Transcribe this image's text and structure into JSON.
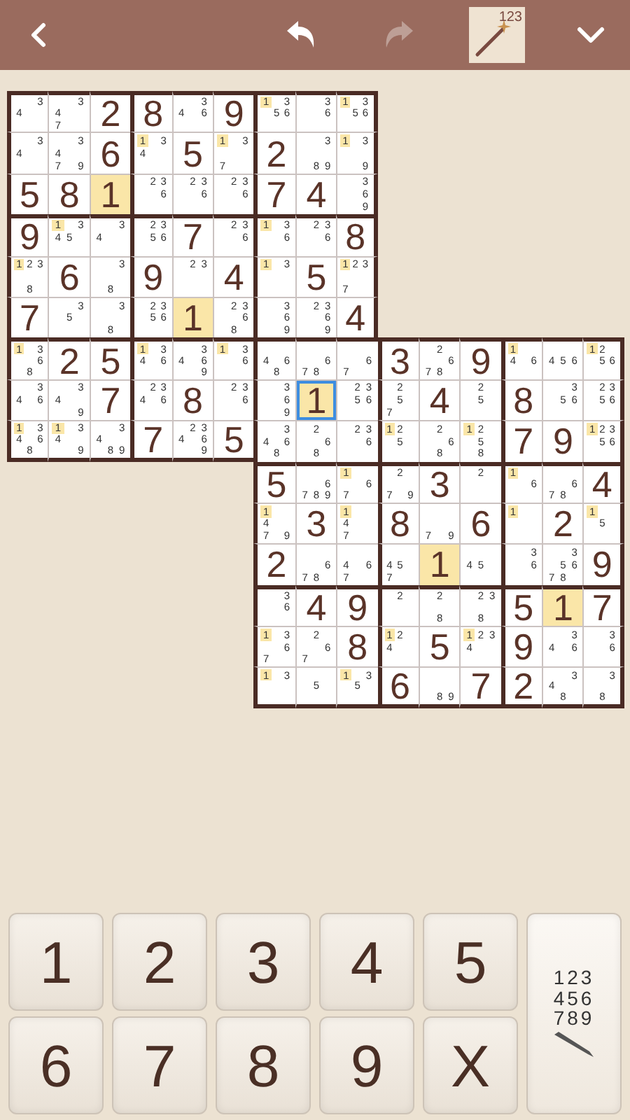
{
  "toolbar": {
    "undo": {
      "disabled": false
    },
    "redo": {
      "disabled": true
    },
    "hint": {
      "label": "123",
      "selected": true
    }
  },
  "board": {
    "rows": [
      {
        "cells": [
          {
            "kind": "notes",
            "notes": [
              "3",
              "4"
            ],
            "highlighted": false,
            "selected": false
          },
          {
            "kind": "notes",
            "notes": [
              "3",
              "4",
              "7"
            ],
            "highlighted": false,
            "selected": false
          },
          {
            "kind": "value",
            "text": "2",
            "highlighted": false,
            "selected": false
          },
          {
            "kind": "value",
            "text": "8",
            "highlighted": false,
            "selected": false
          },
          {
            "kind": "notes",
            "notes": [
              "3",
              "4",
              "6"
            ],
            "highlighted": false,
            "selected": false
          },
          {
            "kind": "value",
            "text": "9",
            "highlighted": false,
            "selected": false
          },
          {
            "kind": "notes",
            "notes": [
              "1",
              "3",
              "5",
              "6"
            ],
            "highlighted": true,
            "selected": false
          },
          {
            "kind": "notes",
            "notes": [
              "3",
              "6"
            ],
            "highlighted": false,
            "selected": false
          },
          {
            "kind": "notes",
            "notes": [
              "1",
              "3",
              "5",
              "6"
            ],
            "highlighted": true,
            "selected": false
          }
        ]
      },
      {
        "cells": [
          {
            "kind": "notes",
            "notes": [
              "3",
              "4"
            ],
            "highlighted": false,
            "selected": false
          },
          {
            "kind": "notes",
            "notes": [
              "3",
              "4",
              "7",
              "9"
            ],
            "highlighted": false,
            "selected": false
          },
          {
            "kind": "value",
            "text": "6",
            "highlighted": false,
            "selected": false
          },
          {
            "kind": "notes",
            "notes": [
              "1",
              "3",
              "4"
            ],
            "highlighted": true,
            "selected": false
          },
          {
            "kind": "value",
            "text": "5",
            "highlighted": false,
            "selected": false
          },
          {
            "kind": "notes",
            "notes": [
              "1",
              "3",
              "7"
            ],
            "highlighted": true,
            "selected": false
          },
          {
            "kind": "value",
            "text": "2",
            "highlighted": false,
            "selected": false
          },
          {
            "kind": "notes",
            "notes": [
              "3",
              "8",
              "9"
            ],
            "highlighted": false,
            "selected": false
          },
          {
            "kind": "notes",
            "notes": [
              "1",
              "3",
              "9"
            ],
            "highlighted": true,
            "selected": false
          }
        ]
      },
      {
        "cells": [
          {
            "kind": "value",
            "text": "5",
            "highlighted": false,
            "selected": false
          },
          {
            "kind": "value",
            "text": "8",
            "highlighted": false,
            "selected": false
          },
          {
            "kind": "value",
            "text": "1",
            "highlighted": true,
            "selected": false
          },
          {
            "kind": "notes",
            "notes": [
              "2",
              "3",
              "6"
            ],
            "highlighted": false,
            "selected": false
          },
          {
            "kind": "notes",
            "notes": [
              "2",
              "3",
              "6"
            ],
            "highlighted": false,
            "selected": false
          },
          {
            "kind": "notes",
            "notes": [
              "2",
              "3",
              "6"
            ],
            "highlighted": false,
            "selected": false
          },
          {
            "kind": "value",
            "text": "7",
            "highlighted": false,
            "selected": false
          },
          {
            "kind": "value",
            "text": "4",
            "highlighted": false,
            "selected": false
          },
          {
            "kind": "notes",
            "notes": [
              "3",
              "6",
              "9"
            ],
            "highlighted": false,
            "selected": false
          }
        ]
      },
      {
        "cells": [
          {
            "kind": "value",
            "text": "9",
            "highlighted": false,
            "selected": false
          },
          {
            "kind": "notes",
            "notes": [
              "1",
              "3",
              "4",
              "5"
            ],
            "highlighted": true,
            "selected": false
          },
          {
            "kind": "notes",
            "notes": [
              "3",
              "4"
            ],
            "highlighted": false,
            "selected": false
          },
          {
            "kind": "notes",
            "notes": [
              "2",
              "3",
              "5",
              "6"
            ],
            "highlighted": false,
            "selected": false
          },
          {
            "kind": "value",
            "text": "7",
            "highlighted": false,
            "selected": false
          },
          {
            "kind": "notes",
            "notes": [
              "2",
              "3",
              "6"
            ],
            "highlighted": false,
            "selected": false
          },
          {
            "kind": "notes",
            "notes": [
              "1",
              "3",
              "6"
            ],
            "highlighted": true,
            "selected": false
          },
          {
            "kind": "notes",
            "notes": [
              "2",
              "3",
              "6"
            ],
            "highlighted": false,
            "selected": false
          },
          {
            "kind": "value",
            "text": "8",
            "highlighted": false,
            "selected": false
          }
        ]
      },
      {
        "cells": [
          {
            "kind": "notes",
            "notes": [
              "1",
              "2",
              "3",
              "8"
            ],
            "highlighted": true,
            "selected": false
          },
          {
            "kind": "value",
            "text": "6",
            "highlighted": false,
            "selected": false
          },
          {
            "kind": "notes",
            "notes": [
              "3",
              "8"
            ],
            "highlighted": false,
            "selected": false
          },
          {
            "kind": "value",
            "text": "9",
            "highlighted": false,
            "selected": false
          },
          {
            "kind": "notes",
            "notes": [
              "2",
              "3"
            ],
            "highlighted": false,
            "selected": false
          },
          {
            "kind": "value",
            "text": "4",
            "highlighted": false,
            "selected": false
          },
          {
            "kind": "notes",
            "notes": [
              "1",
              "3"
            ],
            "highlighted": true,
            "selected": false
          },
          {
            "kind": "value",
            "text": "5",
            "highlighted": false,
            "selected": false
          },
          {
            "kind": "notes",
            "notes": [
              "1",
              "2",
              "3",
              "7"
            ],
            "highlighted": true,
            "selected": false
          }
        ]
      },
      {
        "cells": [
          {
            "kind": "value",
            "text": "7",
            "highlighted": false,
            "selected": false
          },
          {
            "kind": "notes",
            "notes": [
              "3",
              "5"
            ],
            "highlighted": false,
            "selected": false
          },
          {
            "kind": "notes",
            "notes": [
              "3",
              "8"
            ],
            "highlighted": false,
            "selected": false
          },
          {
            "kind": "notes",
            "notes": [
              "2",
              "3",
              "5",
              "6"
            ],
            "highlighted": false,
            "selected": false
          },
          {
            "kind": "value",
            "text": "1",
            "highlighted": true,
            "selected": false
          },
          {
            "kind": "notes",
            "notes": [
              "2",
              "3",
              "6",
              "8"
            ],
            "highlighted": false,
            "selected": false
          },
          {
            "kind": "notes",
            "notes": [
              "3",
              "6",
              "9"
            ],
            "highlighted": false,
            "selected": false
          },
          {
            "kind": "notes",
            "notes": [
              "2",
              "3",
              "6",
              "9"
            ],
            "highlighted": false,
            "selected": false
          },
          {
            "kind": "value",
            "text": "4",
            "highlighted": false,
            "selected": false
          }
        ]
      },
      {
        "cells": [
          {
            "kind": "notes",
            "notes": [
              "1",
              "3",
              "6",
              "8"
            ],
            "highlighted": true,
            "selected": false
          },
          {
            "kind": "value",
            "text": "2",
            "highlighted": false,
            "selected": false
          },
          {
            "kind": "value",
            "text": "5",
            "highlighted": false,
            "selected": false
          },
          {
            "kind": "notes",
            "notes": [
              "1",
              "3",
              "4",
              "6"
            ],
            "highlighted": true,
            "selected": false
          },
          {
            "kind": "notes",
            "notes": [
              "3",
              "4",
              "6",
              "9"
            ],
            "highlighted": false,
            "selected": false
          },
          {
            "kind": "notes",
            "notes": [
              "1",
              "3",
              "6"
            ],
            "highlighted": true,
            "selected": false
          },
          {
            "kind": "notes",
            "notes": [
              "4",
              "6",
              "8"
            ],
            "highlighted": false,
            "selected": false
          },
          {
            "kind": "notes",
            "notes": [
              "6",
              "7",
              "8"
            ],
            "highlighted": false,
            "selected": false
          },
          {
            "kind": "notes",
            "notes": [
              "6",
              "7"
            ],
            "highlighted": false,
            "selected": false
          },
          {
            "kind": "value",
            "text": "3",
            "highlighted": false,
            "selected": false
          },
          {
            "kind": "notes",
            "notes": [
              "2",
              "6",
              "7",
              "8"
            ],
            "highlighted": false,
            "selected": false
          },
          {
            "kind": "value",
            "text": "9",
            "highlighted": false,
            "selected": false
          },
          {
            "kind": "notes",
            "notes": [
              "1",
              "4",
              "6"
            ],
            "highlighted": true,
            "selected": false
          },
          {
            "kind": "notes",
            "notes": [
              "4",
              "5",
              "6"
            ],
            "highlighted": false,
            "selected": false
          },
          {
            "kind": "notes",
            "notes": [
              "1",
              "2",
              "5",
              "6"
            ],
            "highlighted": true,
            "selected": false
          }
        ]
      },
      {
        "cells": [
          {
            "kind": "notes",
            "notes": [
              "3",
              "4",
              "6"
            ],
            "highlighted": false,
            "selected": false
          },
          {
            "kind": "notes",
            "notes": [
              "3",
              "4",
              "9"
            ],
            "highlighted": false,
            "selected": false
          },
          {
            "kind": "value",
            "text": "7",
            "highlighted": false,
            "selected": false
          },
          {
            "kind": "notes",
            "notes": [
              "2",
              "3",
              "4",
              "6"
            ],
            "highlighted": false,
            "selected": false
          },
          {
            "kind": "value",
            "text": "8",
            "highlighted": false,
            "selected": false
          },
          {
            "kind": "notes",
            "notes": [
              "2",
              "3",
              "6"
            ],
            "highlighted": false,
            "selected": false
          },
          {
            "kind": "notes",
            "notes": [
              "3",
              "6",
              "9"
            ],
            "highlighted": false,
            "selected": false
          },
          {
            "kind": "value",
            "text": "1",
            "highlighted": true,
            "selected": true
          },
          {
            "kind": "notes",
            "notes": [
              "2",
              "3",
              "5",
              "6"
            ],
            "highlighted": false,
            "selected": false
          },
          {
            "kind": "notes",
            "notes": [
              "2",
              "5",
              "7"
            ],
            "highlighted": false,
            "selected": false
          },
          {
            "kind": "value",
            "text": "4",
            "highlighted": false,
            "selected": false
          },
          {
            "kind": "notes",
            "notes": [
              "2",
              "5"
            ],
            "highlighted": false,
            "selected": false
          },
          {
            "kind": "value",
            "text": "8",
            "highlighted": false,
            "selected": false
          },
          {
            "kind": "notes",
            "notes": [
              "3",
              "5",
              "6"
            ],
            "highlighted": false,
            "selected": false
          },
          {
            "kind": "notes",
            "notes": [
              "2",
              "3",
              "5",
              "6"
            ],
            "highlighted": false,
            "selected": false
          }
        ]
      },
      {
        "cells": [
          {
            "kind": "notes",
            "notes": [
              "1",
              "3",
              "4",
              "6",
              "8"
            ],
            "highlighted": true,
            "selected": false
          },
          {
            "kind": "notes",
            "notes": [
              "1",
              "3",
              "4",
              "9"
            ],
            "highlighted": true,
            "selected": false
          },
          {
            "kind": "notes",
            "notes": [
              "3",
              "4",
              "8",
              "9"
            ],
            "highlighted": false,
            "selected": false
          },
          {
            "kind": "value",
            "text": "7",
            "highlighted": false,
            "selected": false
          },
          {
            "kind": "notes",
            "notes": [
              "2",
              "3",
              "4",
              "6",
              "9"
            ],
            "highlighted": false,
            "selected": false
          },
          {
            "kind": "value",
            "text": "5",
            "highlighted": false,
            "selected": false
          },
          {
            "kind": "notes",
            "notes": [
              "3",
              "4",
              "6",
              "8"
            ],
            "highlighted": false,
            "selected": false
          },
          {
            "kind": "notes",
            "notes": [
              "2",
              "6",
              "8"
            ],
            "highlighted": false,
            "selected": false
          },
          {
            "kind": "notes",
            "notes": [
              "2",
              "3",
              "6"
            ],
            "highlighted": false,
            "selected": false
          },
          {
            "kind": "notes",
            "notes": [
              "1",
              "2",
              "5"
            ],
            "highlighted": true,
            "selected": false
          },
          {
            "kind": "notes",
            "notes": [
              "2",
              "6",
              "8"
            ],
            "highlighted": false,
            "selected": false
          },
          {
            "kind": "notes",
            "notes": [
              "1",
              "2",
              "5",
              "8"
            ],
            "highlighted": true,
            "selected": false
          },
          {
            "kind": "value",
            "text": "7",
            "highlighted": false,
            "selected": false
          },
          {
            "kind": "value",
            "text": "9",
            "highlighted": false,
            "selected": false
          },
          {
            "kind": "notes",
            "notes": [
              "1",
              "2",
              "3",
              "5",
              "6"
            ],
            "highlighted": true,
            "selected": false
          }
        ]
      },
      {
        "cells": [
          {
            "kind": "value",
            "text": "5",
            "highlighted": false,
            "selected": false
          },
          {
            "kind": "notes",
            "notes": [
              "6",
              "7",
              "8",
              "9"
            ],
            "highlighted": false,
            "selected": false
          },
          {
            "kind": "notes",
            "notes": [
              "1",
              "6",
              "7"
            ],
            "highlighted": true,
            "selected": false
          },
          {
            "kind": "notes",
            "notes": [
              "2",
              "7",
              "9"
            ],
            "highlighted": false,
            "selected": false
          },
          {
            "kind": "value",
            "text": "3",
            "highlighted": false,
            "selected": false
          },
          {
            "kind": "notes",
            "notes": [
              "2"
            ],
            "highlighted": false,
            "selected": false
          },
          {
            "kind": "notes",
            "notes": [
              "1",
              "6"
            ],
            "highlighted": true,
            "selected": false
          },
          {
            "kind": "notes",
            "notes": [
              "6",
              "7",
              "8"
            ],
            "highlighted": false,
            "selected": false
          },
          {
            "kind": "value",
            "text": "4",
            "highlighted": false,
            "selected": false
          }
        ]
      },
      {
        "cells": [
          {
            "kind": "notes",
            "notes": [
              "1",
              "4",
              "7",
              "9"
            ],
            "highlighted": true,
            "selected": false
          },
          {
            "kind": "value",
            "text": "3",
            "highlighted": false,
            "selected": false
          },
          {
            "kind": "notes",
            "notes": [
              "1",
              "4",
              "7"
            ],
            "highlighted": true,
            "selected": false
          },
          {
            "kind": "value",
            "text": "8",
            "highlighted": false,
            "selected": false
          },
          {
            "kind": "notes",
            "notes": [
              "7",
              "9"
            ],
            "highlighted": false,
            "selected": false
          },
          {
            "kind": "value",
            "text": "6",
            "highlighted": false,
            "selected": false
          },
          {
            "kind": "notes",
            "notes": [
              "1"
            ],
            "highlighted": true,
            "selected": false
          },
          {
            "kind": "value",
            "text": "2",
            "highlighted": false,
            "selected": false
          },
          {
            "kind": "notes",
            "notes": [
              "1",
              "5"
            ],
            "highlighted": true,
            "selected": false
          }
        ]
      },
      {
        "cells": [
          {
            "kind": "value",
            "text": "2",
            "highlighted": false,
            "selected": false
          },
          {
            "kind": "notes",
            "notes": [
              "6",
              "7",
              "8"
            ],
            "highlighted": false,
            "selected": false
          },
          {
            "kind": "notes",
            "notes": [
              "4",
              "6",
              "7"
            ],
            "highlighted": false,
            "selected": false
          },
          {
            "kind": "notes",
            "notes": [
              "4",
              "5",
              "7"
            ],
            "highlighted": false,
            "selected": false
          },
          {
            "kind": "value",
            "text": "1",
            "highlighted": true,
            "selected": false
          },
          {
            "kind": "notes",
            "notes": [
              "4",
              "5"
            ],
            "highlighted": false,
            "selected": false
          },
          {
            "kind": "notes",
            "notes": [
              "3",
              "6"
            ],
            "highlighted": false,
            "selected": false
          },
          {
            "kind": "notes",
            "notes": [
              "3",
              "5",
              "6",
              "7",
              "8"
            ],
            "highlighted": false,
            "selected": false
          },
          {
            "kind": "value",
            "text": "9",
            "highlighted": false,
            "selected": false
          }
        ]
      },
      {
        "cells": [
          {
            "kind": "notes",
            "notes": [
              "3",
              "6"
            ],
            "highlighted": false,
            "selected": false
          },
          {
            "kind": "value",
            "text": "4",
            "highlighted": false,
            "selected": false
          },
          {
            "kind": "value",
            "text": "9",
            "highlighted": false,
            "selected": false
          },
          {
            "kind": "notes",
            "notes": [
              "2"
            ],
            "highlighted": false,
            "selected": false
          },
          {
            "kind": "notes",
            "notes": [
              "2",
              "8"
            ],
            "highlighted": false,
            "selected": false
          },
          {
            "kind": "notes",
            "notes": [
              "2",
              "3",
              "8"
            ],
            "highlighted": false,
            "selected": false
          },
          {
            "kind": "value",
            "text": "5",
            "highlighted": false,
            "selected": false
          },
          {
            "kind": "value",
            "text": "1",
            "highlighted": true,
            "selected": false
          },
          {
            "kind": "value",
            "text": "7",
            "highlighted": false,
            "selected": false
          }
        ]
      },
      {
        "cells": [
          {
            "kind": "notes",
            "notes": [
              "1",
              "3",
              "6",
              "7"
            ],
            "highlighted": true,
            "selected": false
          },
          {
            "kind": "notes",
            "notes": [
              "2",
              "6",
              "7"
            ],
            "highlighted": false,
            "selected": false
          },
          {
            "kind": "value",
            "text": "8",
            "highlighted": false,
            "selected": false
          },
          {
            "kind": "notes",
            "notes": [
              "1",
              "2",
              "4"
            ],
            "highlighted": true,
            "selected": false
          },
          {
            "kind": "value",
            "text": "5",
            "highlighted": false,
            "selected": false
          },
          {
            "kind": "notes",
            "notes": [
              "1",
              "2",
              "3",
              "4"
            ],
            "highlighted": true,
            "selected": false
          },
          {
            "kind": "value",
            "text": "9",
            "highlighted": false,
            "selected": false
          },
          {
            "kind": "notes",
            "notes": [
              "3",
              "4",
              "6"
            ],
            "highlighted": false,
            "selected": false
          },
          {
            "kind": "notes",
            "notes": [
              "3",
              "6"
            ],
            "highlighted": false,
            "selected": false
          }
        ]
      },
      {
        "cells": [
          {
            "kind": "notes",
            "notes": [
              "1",
              "3"
            ],
            "highlighted": true,
            "selected": false
          },
          {
            "kind": "notes",
            "notes": [
              "5"
            ],
            "highlighted": false,
            "selected": false
          },
          {
            "kind": "notes",
            "notes": [
              "1",
              "3",
              "5"
            ],
            "highlighted": true,
            "selected": false
          },
          {
            "kind": "value",
            "text": "6",
            "highlighted": false,
            "selected": false
          },
          {
            "kind": "notes",
            "notes": [
              "8",
              "9"
            ],
            "highlighted": false,
            "selected": false
          },
          {
            "kind": "value",
            "text": "7",
            "highlighted": false,
            "selected": false
          },
          {
            "kind": "value",
            "text": "2",
            "highlighted": false,
            "selected": false
          },
          {
            "kind": "notes",
            "notes": [
              "3",
              "4",
              "8"
            ],
            "highlighted": false,
            "selected": false
          },
          {
            "kind": "notes",
            "notes": [
              "3",
              "8"
            ],
            "highlighted": false,
            "selected": false
          }
        ]
      }
    ]
  },
  "keypad": {
    "digit_keys": [
      "1",
      "2",
      "3",
      "4",
      "5",
      "6",
      "7",
      "8",
      "9"
    ],
    "erase_key": {
      "label": "X"
    },
    "notes_key": {
      "lines": [
        "123",
        "456",
        "789"
      ]
    }
  }
}
